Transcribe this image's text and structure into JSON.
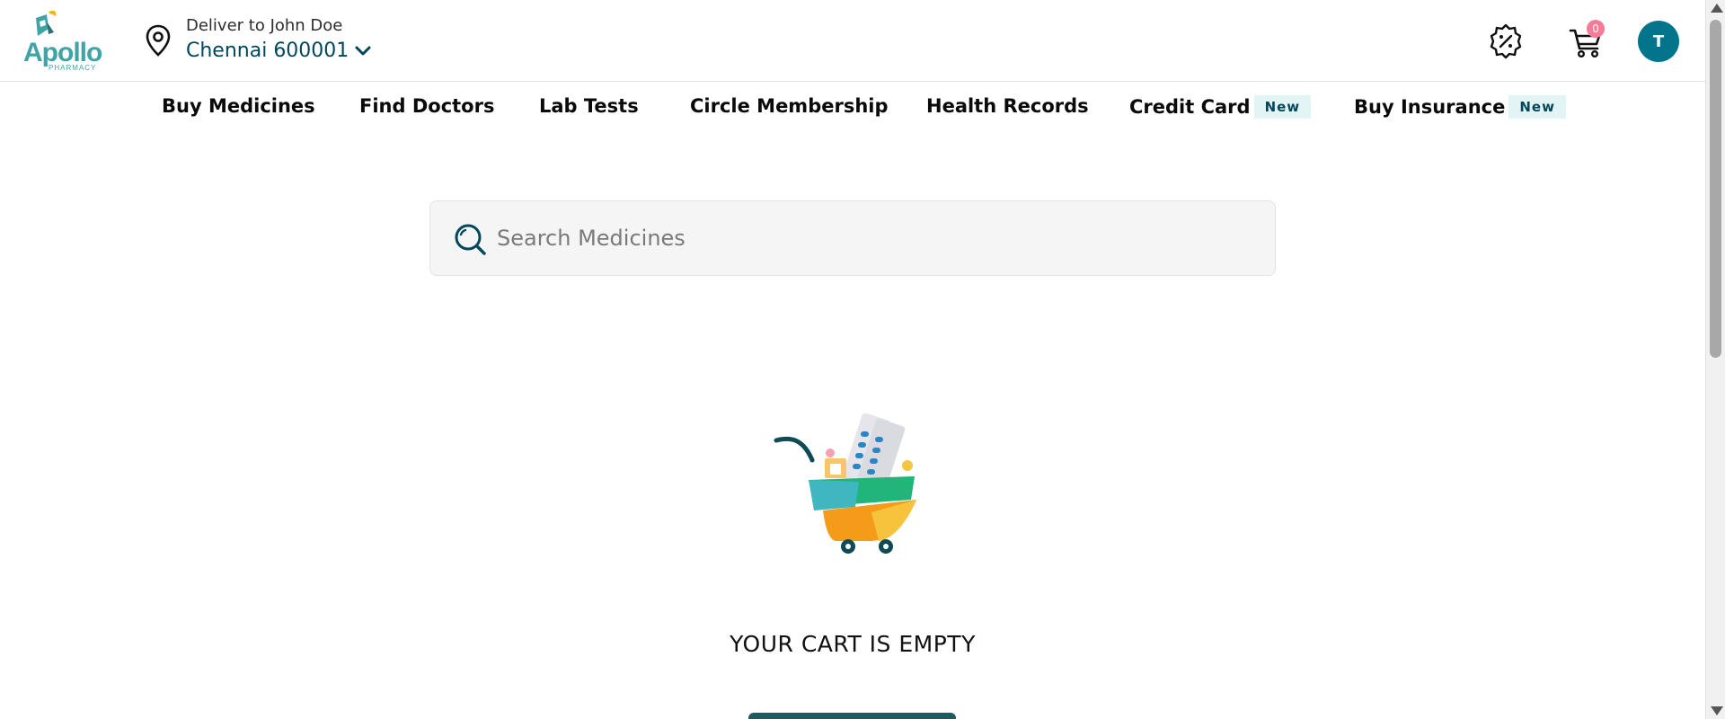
{
  "brand": {
    "name": "Apollo",
    "sub": "PHARMACY",
    "color": "#40a4a7"
  },
  "location": {
    "deliver_label": "Deliver to John Doe",
    "city": "Chennai 600001"
  },
  "header": {
    "offer_icon": "percent-badge-icon",
    "cart_count": "0",
    "avatar_initial": "T"
  },
  "nav": {
    "items": [
      {
        "label": "Buy Medicines"
      },
      {
        "label": "Find Doctors"
      },
      {
        "label": "Lab Tests"
      },
      {
        "label": "Circle Membership"
      },
      {
        "label": "Health Records"
      },
      {
        "label": "Credit Card",
        "badge": "New"
      },
      {
        "label": "Buy Insurance",
        "badge": "New"
      }
    ]
  },
  "search": {
    "placeholder": "Search Medicines"
  },
  "cart": {
    "empty_message": "YOUR CART IS EMPTY"
  },
  "colors": {
    "primary": "#02475b",
    "accent": "#02758c",
    "badge": "#f97b95",
    "cta": "#1e5b5f"
  }
}
